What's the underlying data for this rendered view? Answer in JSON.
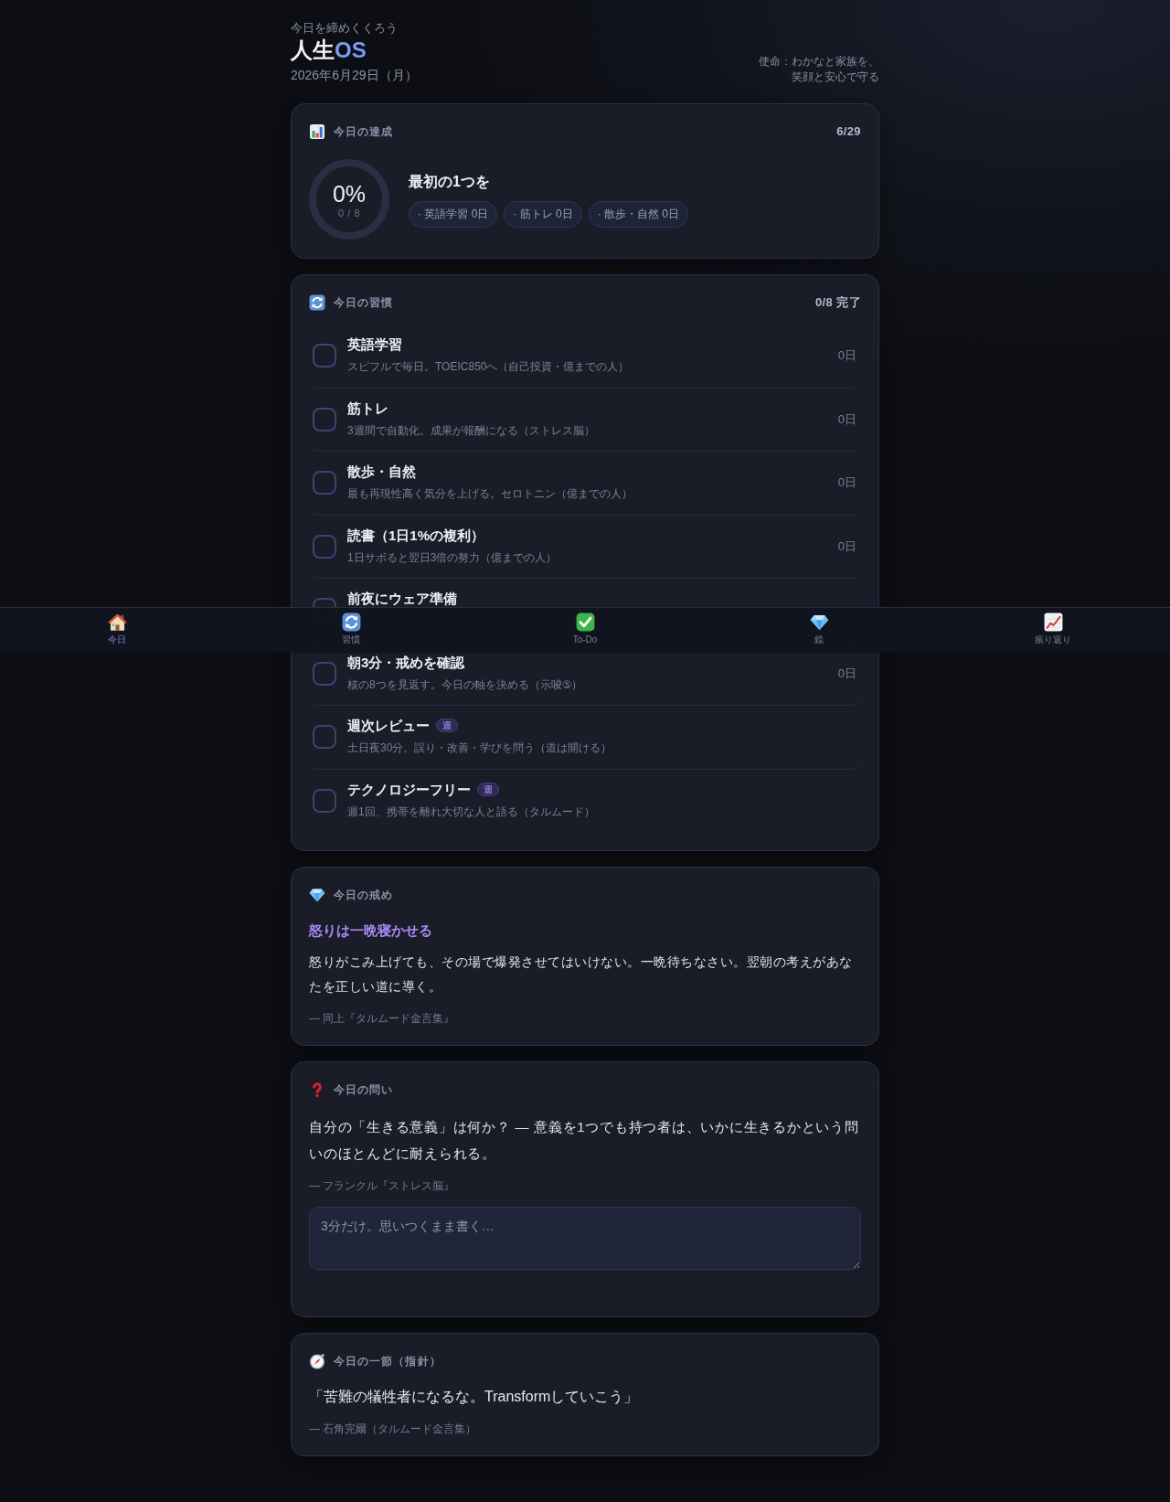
{
  "header": {
    "eyebrow": "今日を締めくくろう",
    "title": [
      {
        "text": "人生",
        "accent": false
      },
      {
        "text": "OS",
        "accent": true
      }
    ],
    "date": "2026年6月29日（月）",
    "mission": "使命：わかなと家族を、笑顔と安心で守る"
  },
  "achievement": {
    "label": "今日の達成",
    "date_badge": "6/29",
    "percent": "0%",
    "count": "0 / 8",
    "level": 0,
    "headline": "最初の1つを",
    "streaks": [
      "· 英語学習 0日",
      "· 筋トレ 0日",
      "· 散歩・自然 0日"
    ]
  },
  "habits": {
    "label": "今日の習慣",
    "summary": "0/8 完了",
    "items": [
      {
        "title": "英語学習",
        "description": "スピフルで毎日。TOEIC850へ（自己投資・億までの人）",
        "streak": "0日",
        "checked": false
      },
      {
        "title": "筋トレ",
        "description": "3週間で自動化。成果が報酬になる（ストレス脳）",
        "streak": "0日",
        "checked": false
      },
      {
        "title": "散歩・自然",
        "description": "最も再現性高く気分を上げる。セロトニン（億までの人）",
        "streak": "0日",
        "checked": false
      },
      {
        "title": "読書（1日1%の複利）",
        "description": "1日サボると翌日3倍の努力（億までの人）",
        "streak": "0日",
        "checked": false
      },
      {
        "title": "前夜にウェア準備",
        "checked": false
      },
      {
        "title": "朝3分・戒めを確認",
        "description": "核の8つを見返す。今日の軸を決める（示唆⑤）",
        "streak": "0日",
        "checked": false
      },
      {
        "title": "週次レビュー",
        "tag": "週",
        "description": "土日夜30分。誤り・改善・学びを問う（道は開ける）",
        "checked": false
      },
      {
        "title": "テクノロジーフリー",
        "tag": "週",
        "description": "週1回、携帯を離れ大切な人と語る（タルムード）",
        "checked": false
      }
    ]
  },
  "admonition": {
    "label": "今日の戒め",
    "title": "怒りは一晩寝かせる",
    "body": "怒りがこみ上げても、その場で爆発させてはいけない。一晩待ちなさい。翌朝の考えがあなたを正しい道に導く。",
    "source": "— 同上『タルムード金言集』"
  },
  "question": {
    "label": "今日の問い",
    "body": "自分の「生きる意義」は何か？ — 意義を1つでも持つ者は、いかに生きるかという問いのほとんどに耐えられる。",
    "source": "— フランクル『ストレス脳』",
    "answer": {
      "placeholder": "3分だけ。思いつくまま書く…"
    }
  },
  "passage": {
    "label": "今日の一節（指針）",
    "quote": "「苦難の犠牲者になるな。Transformしていこう」",
    "source": "— 石角完爾（タルムード金言集）"
  },
  "bottom_nav": [
    {
      "label": "今日",
      "selected": true
    },
    {
      "label": "習慣",
      "selected": false
    },
    {
      "label": "To-Do",
      "selected": false
    },
    {
      "label": "鏡",
      "selected": false
    },
    {
      "label": "振り返り",
      "selected": false
    }
  ]
}
